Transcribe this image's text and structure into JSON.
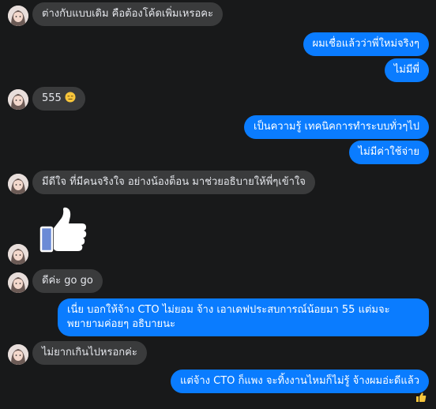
{
  "messages": [
    {
      "side": "in",
      "text": "ต่างกับแบบเดิม คือต้องโค้ดเพิ่มเหรอคะ"
    },
    {
      "side": "out",
      "text": "ผมเชื่อแล้วว่าพี่ใหม่จริงๆ"
    },
    {
      "side": "out",
      "text": "ไม่มีพี่"
    },
    {
      "side": "in",
      "text": "555"
    },
    {
      "side": "out",
      "text": "เป็นความรู้ เทคนิคการทำระบบทั่วๆไป"
    },
    {
      "side": "out",
      "text": "ไม่มีค่าใช้จ่าย"
    },
    {
      "side": "in",
      "text": "มีดีใจ ที่มีคนจริงใจ อย่างน้องต็อน มาช่วยอธิบายให้พี่ๆเข้าใจ"
    },
    {
      "side": "in",
      "text": "ดีค่ะ go go"
    },
    {
      "side": "out",
      "text": "เนี่ย บอกให้จ้าง CTO ไม่ยอม จ้าง เอาเดฟประสบการณ์น้อยมา 55 แต่มจะพยายามค่อยๆ อธิบายนะ"
    },
    {
      "side": "in",
      "text": "ไม่ยากเกินไปหรอกค่ะ"
    },
    {
      "side": "out",
      "text": "แต่จ้าง CTO ก็แพง จะทิ้งงานไหมก็ไม่รู้ จ้างผมอ่ะดีแล้ว"
    }
  ],
  "icons": {
    "inline_emoji": "expressionless-face-icon",
    "big_reaction": "thumbs-up-icon",
    "seen_reaction": "thumbs-up-icon",
    "avatar": "user-avatar"
  },
  "colors": {
    "background": "#18191a",
    "incoming_bubble": "#3a3b3c",
    "outgoing_bubble": "#0a7cff",
    "thumb_blue": "#6b8bd6"
  }
}
